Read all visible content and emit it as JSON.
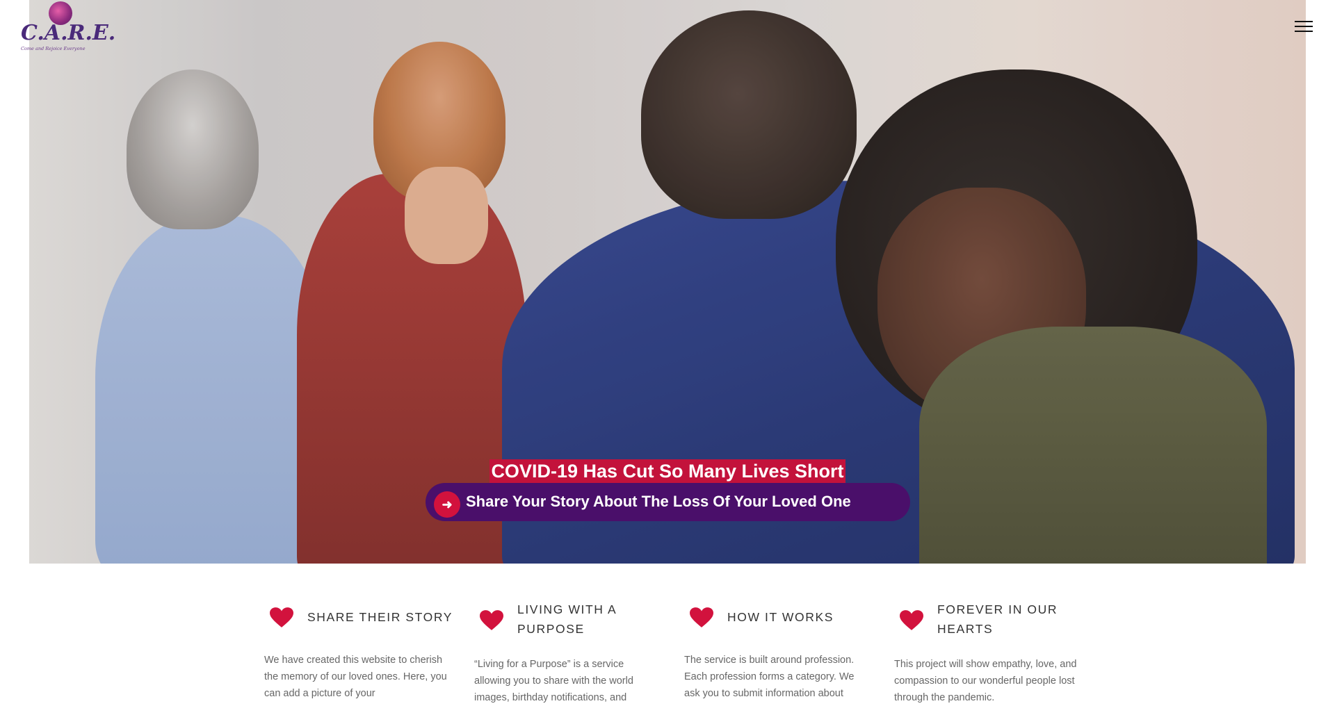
{
  "brand": {
    "logo_text": "C.A.R.E.",
    "tagline": "Come and Rejoice Everyone"
  },
  "hero": {
    "title": "COVID-19 Has Cut So Many Lives Short",
    "cta_label": "Share Your Story About The Loss Of Your Loved One",
    "cta_icon": "arrow-right-icon"
  },
  "colors": {
    "accent_red": "#c3123b",
    "cta_purple": "#4a0f6a"
  },
  "features": [
    {
      "icon": "heart-icon",
      "title": "SHARE THEIR STORY",
      "desc": "We have created this website to cherish the memory of our loved ones. Here, you can add a picture of your"
    },
    {
      "icon": "heart-icon",
      "title": "LIVING WITH A PURPOSE",
      "desc": "“Living for a Purpose” is a service allowing you to share with the world images, birthday notifications, and"
    },
    {
      "icon": "heart-icon",
      "title": "HOW IT WORKS",
      "desc": "The service is built around profession. Each profession forms a category. We ask you to submit information about"
    },
    {
      "icon": "heart-icon",
      "title": "FOREVER IN OUR HEARTS",
      "desc": "This project will show empathy, love, and compassion to our wonderful people lost through the pandemic."
    }
  ]
}
